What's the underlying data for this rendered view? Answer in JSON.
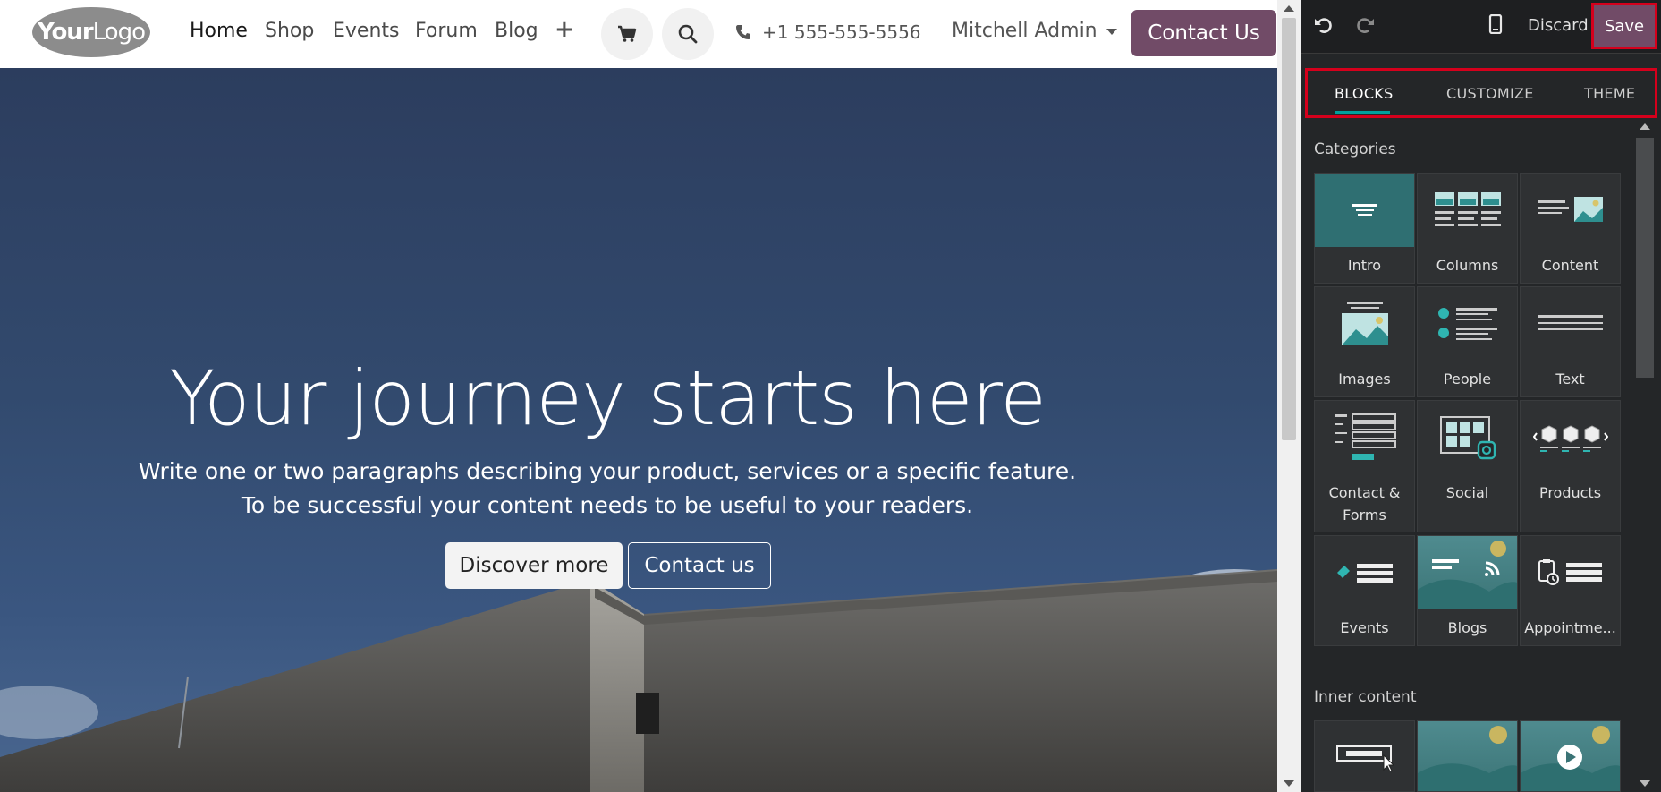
{
  "site": {
    "logo": {
      "part1": "Your",
      "part2": "Logo"
    },
    "nav": {
      "home": "Home",
      "shop": "Shop",
      "events": "Events",
      "forum": "Forum",
      "blog": "Blog",
      "add": "+"
    },
    "phone": "+1 555-555-5556",
    "user": "Mitchell Admin",
    "contact_button": "Contact Us",
    "hero": {
      "title": "Your journey starts here",
      "line1": "Write one or two paragraphs describing your product, services or a specific feature.",
      "line2": "To be successful your content needs to be useful to your readers.",
      "primary_button": "Discover more",
      "secondary_button": "Contact us"
    }
  },
  "editor": {
    "discard": "Discard",
    "save": "Save",
    "tabs": [
      "BLOCKS",
      "CUSTOMIZE",
      "THEME"
    ],
    "active_tab": "BLOCKS",
    "categories_label": "Categories",
    "categories": [
      {
        "label": "Intro",
        "icon": "intro-icon"
      },
      {
        "label": "Columns",
        "icon": "columns-icon"
      },
      {
        "label": "Content",
        "icon": "content-icon"
      },
      {
        "label": "Images",
        "icon": "images-icon"
      },
      {
        "label": "People",
        "icon": "people-icon"
      },
      {
        "label": "Text",
        "icon": "text-icon"
      },
      {
        "label": "Contact &",
        "label2": "Forms",
        "icon": "contact-forms-icon"
      },
      {
        "label": "Social",
        "icon": "social-icon"
      },
      {
        "label": "Products",
        "icon": "products-icon"
      },
      {
        "label": "Events",
        "icon": "events-icon"
      },
      {
        "label": "Blogs",
        "icon": "blogs-icon"
      },
      {
        "label": "Appointme...",
        "icon": "appointments-icon"
      }
    ],
    "inner_content_label": "Inner content",
    "inner_content": [
      {
        "icon": "button-block-icon"
      },
      {
        "icon": "image-block-icon"
      },
      {
        "icon": "video-block-icon"
      }
    ]
  },
  "colors": {
    "brand": "#714b67",
    "accent": "#00a09d",
    "highlight": "#d5001c",
    "panel_bg": "#242628"
  }
}
